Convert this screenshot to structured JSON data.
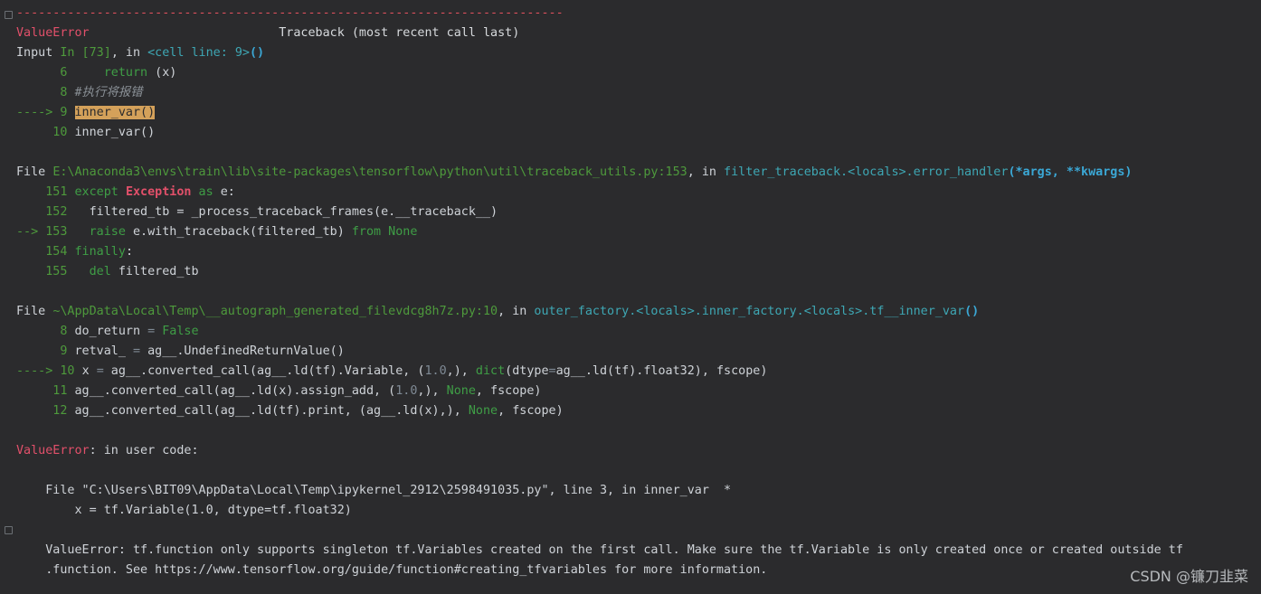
{
  "traceback": {
    "separator": "---------------------------------------------------------------------------",
    "header": {
      "error_name": "ValueError",
      "gap": "                          ",
      "label": "Traceback (most recent call last)"
    },
    "input_line": {
      "prefix": "Input ",
      "cell": "In [73]",
      "mid": ", in ",
      "loc": "<cell line: 9>",
      "paren": "()"
    },
    "cell_lines": {
      "l6_num": "      6 ",
      "l6_kw": "    return",
      "l6_rest": " (x)",
      "l8_num": "      8 ",
      "l8_comment": "#执行将报错",
      "l9_arrow": "----> 9 ",
      "l9_code": "inner_var()",
      "l10_num": "     10 ",
      "l10_code": "inner_var()"
    },
    "frame1": {
      "file_prefix": "File ",
      "path": "E:\\Anaconda3\\envs\\train\\lib\\site-packages\\tensorflow\\python\\util\\traceback_utils.py:153",
      "in_text": ", in ",
      "func": "filter_traceback.<locals>.error_handler",
      "args": "(*args, **kwargs)",
      "l151_num": "    151 ",
      "l151_kw": "except",
      "l151_sp": " ",
      "l151_exc": "Exception",
      "l151_as": " as",
      "l151_rest": " e:",
      "l152_num": "    152 ",
      "l152_code": "  filtered_tb = _process_traceback_frames(e.__traceback__)",
      "l153_arrow": "--> 153 ",
      "l153_kw": "  raise",
      "l153_code": " e.with_traceback(filtered_tb) ",
      "l153_from": "from",
      "l153_none": " None",
      "l154_num": "    154 ",
      "l154_kw": "finally",
      "l154_rest": ":",
      "l155_num": "    155 ",
      "l155_kw": "  del",
      "l155_rest": " filtered_tb"
    },
    "frame2": {
      "file_prefix": "File ",
      "path": "~\\AppData\\Local\\Temp\\__autograph_generated_filevdcg8h7z.py:10",
      "in_text": ", in ",
      "func": "outer_factory.<locals>.inner_factory.<locals>.tf__inner_var",
      "paren": "()",
      "l8_num": "      8 ",
      "l8_code": "do_return ",
      "l8_eq": "=",
      "l8_false": " False",
      "l9_num": "      9 ",
      "l9_code": "retval_ ",
      "l9_eq": "=",
      "l9_rest": " ag__.UndefinedReturnValue()",
      "l10_arrow": "----> 10 ",
      "l10_a": "x ",
      "l10_eq": "=",
      "l10_b": " ag__.converted_call(ag__.ld(tf).Variable, (",
      "l10_num_val": "1.0",
      "l10_c": ",), ",
      "l10_dict": "dict",
      "l10_d": "(dtype",
      "l10_eq2": "=",
      "l10_e": "ag__.ld(tf).float32), fscope)",
      "l11_num": "     11 ",
      "l11_a": "ag__.converted_call(ag__.ld(x).assign_add, (",
      "l11_val": "1.0",
      "l11_b": ",), ",
      "l11_none": "None",
      "l11_c": ", fscope)",
      "l12_num": "     12 ",
      "l12_a": "ag__.converted_call(ag__.ld(tf).print, (ag__.ld(x),), ",
      "l12_none": "None",
      "l12_c": ", fscope)"
    },
    "user_code": {
      "error_name": "ValueError",
      "text": ": in user code:",
      "file_line": "    File \"C:\\Users\\BIT09\\AppData\\Local\\Temp\\ipykernel_2912\\2598491035.py\", line 3, in inner_var  *",
      "code_line": "        x = tf.Variable(1.0, dtype=tf.float32)",
      "msg_line1": "    ValueError: tf.function only supports singleton tf.Variables created on the first call. Make sure the tf.Variable is only created once or created outside tf",
      "msg_line2": "    .function. See https://www.tensorflow.org/guide/function#creating_tfvariables for more information."
    }
  },
  "watermark": "CSDN @镰刀韭菜"
}
